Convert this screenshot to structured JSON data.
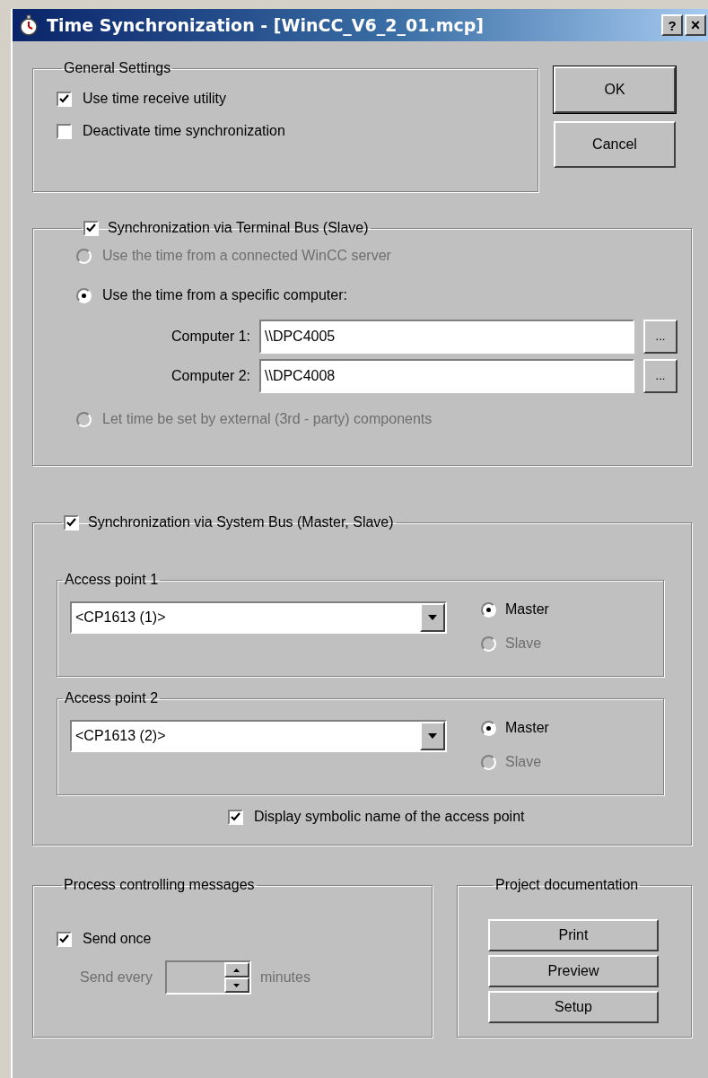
{
  "window": {
    "title": "Time Synchronization - [WinCC_V6_2_01.mcp]",
    "help": "?",
    "close": "×"
  },
  "general_settings": {
    "title": "General Settings",
    "options": [
      {
        "label": "Use time receive utility",
        "checked": true
      },
      {
        "label": "Deactivate time synchronization",
        "checked": false
      }
    ]
  },
  "buttons": [
    "OK",
    "Cancel"
  ],
  "terminal_bus": {
    "title": "Synchronization via Terminal Bus (Slave)",
    "checked": true,
    "options": [
      {
        "label": "Use the time from a connected WinCC server",
        "selected": false,
        "disabled": true
      },
      {
        "label": "Use the time from a specific computer:",
        "selected": true,
        "disabled": false
      },
      {
        "label": "Let time be set by external (3rd - party) components",
        "selected": false,
        "disabled": true
      }
    ],
    "computers": [
      {
        "label": "Computer 1:",
        "value": "\\\\DPC4005",
        "browse": "..."
      },
      {
        "label": "Computer 2:",
        "value": "\\\\DPC4008",
        "browse": "..."
      }
    ]
  },
  "system_bus": {
    "title": "Synchronization via System Bus (Master, Slave)",
    "checked": true,
    "access_points": [
      {
        "title": "Access point 1",
        "value": "<CP1613 (1)>",
        "roles": [
          {
            "label": "Master",
            "selected": true,
            "disabled": false
          },
          {
            "label": "Slave",
            "selected": false,
            "disabled": true
          }
        ]
      },
      {
        "title": "Access point 2",
        "value": "<CP1613 (2)>",
        "roles": [
          {
            "label": "Master",
            "selected": true,
            "disabled": false
          },
          {
            "label": "Slave",
            "selected": false,
            "disabled": true
          }
        ]
      }
    ],
    "display_symbolic": {
      "label": "Display symbolic name of the access point",
      "checked": true
    }
  },
  "process_messages": {
    "title": "Process controlling messages",
    "send_once": {
      "label": "Send once",
      "checked": true
    },
    "send_every": {
      "label": "Send every",
      "unit": "minutes",
      "disabled": true
    }
  },
  "documentation": {
    "title": "Project documentation",
    "buttons": [
      "Print",
      "Preview",
      "Setup"
    ]
  }
}
